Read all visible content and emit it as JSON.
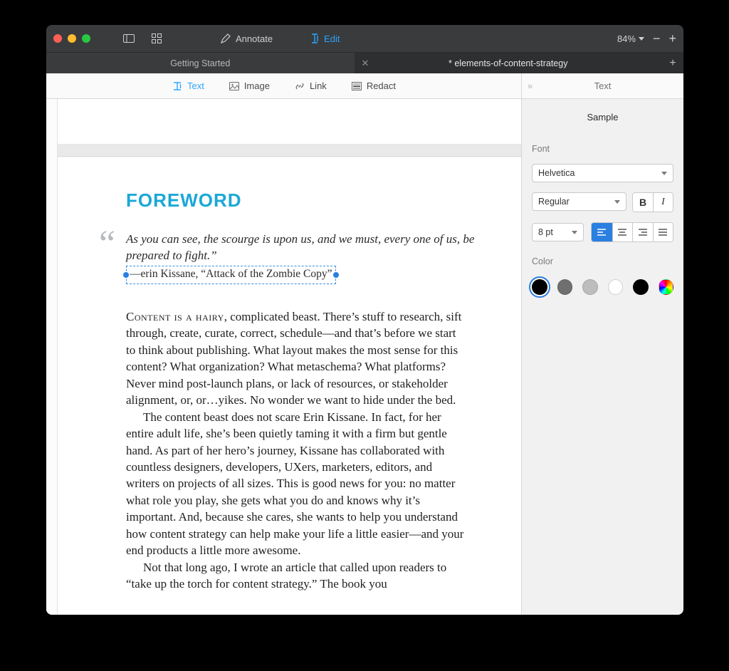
{
  "toolbar": {
    "annotate_label": "Annotate",
    "edit_label": "Edit",
    "zoom_pct": "84%"
  },
  "tabs": {
    "items": [
      {
        "label": "Getting Started",
        "active": false,
        "closeable": false
      },
      {
        "label": "* elements-of-content-strategy",
        "active": true,
        "closeable": true
      }
    ]
  },
  "tools": {
    "text": "Text",
    "image": "Image",
    "link": "Link",
    "redact": "Redact"
  },
  "panel": {
    "title": "Text",
    "sample": "Sample",
    "font_section": "Font",
    "font_family": "Helvetica",
    "font_style": "Regular",
    "font_size": "8 pt",
    "color_section": "Color",
    "swatches": [
      "#000000",
      "#6f6f6f",
      "#bdbdbd",
      "#ffffff",
      "#000000",
      "rainbow"
    ],
    "selected_swatch_index": 0
  },
  "document": {
    "title": "FOREWORD",
    "quote": {
      "text": "As you can see, the scourge is upon us, and we must, every one of us, be prepared to fight.”",
      "attribution_prefix": "—erin Kissane, ",
      "attribution_title": "“Attack of the Zombie Copy”"
    },
    "lead_smallcaps": "Content is a hairy",
    "lead_rest": ", complicated beast. There’s stuff to research, sift through, create, curate, correct, schedule—and that’s before we start to think about publishing. What layout makes the most sense for this content? What organization? What metaschema? What platforms? Never mind post-launch plans, or lack of resources, or stakeholder alignment, or, or…yikes. No wonder we want to hide under the bed.",
    "p2": "The content beast does not scare Erin Kissane. In fact, for her entire adult life, she’s been quietly taming it with a firm but gentle hand. As part of her hero’s journey, Kissane has collaborated with countless designers, developers, UXers, marketers, editors, and writers on projects of all sizes. This is good news for you: no matter what role you play, she gets what you do and knows why it’s important. And, because she cares, she wants to help you understand how content strategy can help make your life a little easier—and your end products a little more awesome.",
    "p3": "Not that long ago, I wrote an article that called upon readers to “take up the torch for content strategy.” The book you"
  }
}
